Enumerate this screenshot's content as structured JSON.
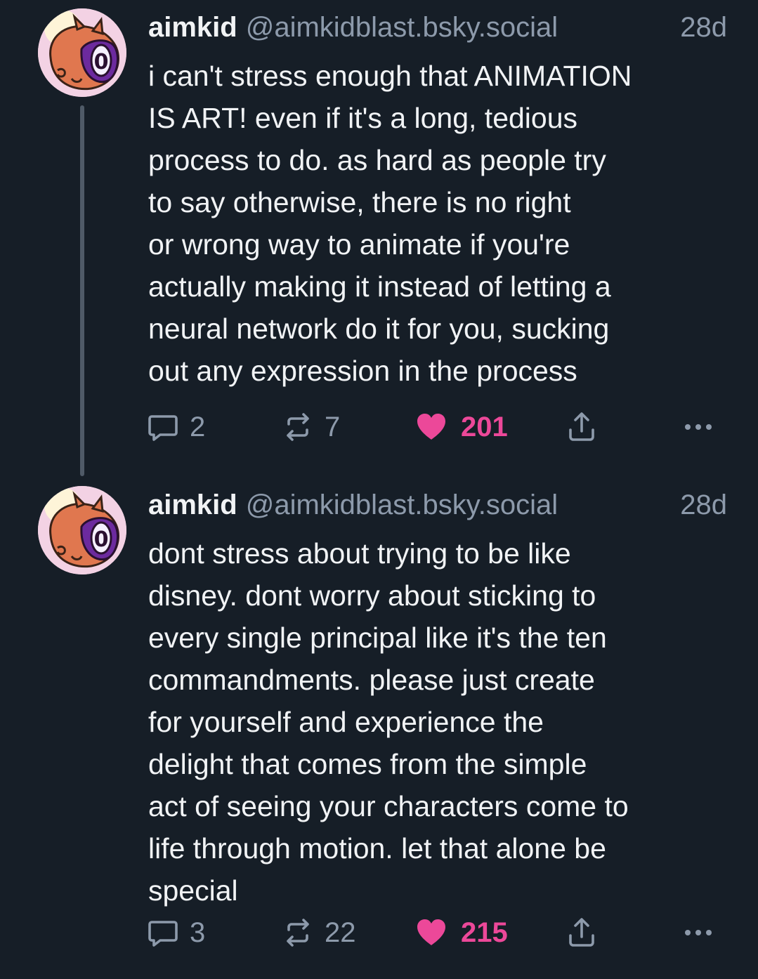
{
  "posts": [
    {
      "author": {
        "display_name": "aimkid",
        "handle": "@aimkidblast.bsky.social",
        "avatar_icon": "avatar-character-icon"
      },
      "time": "28d",
      "text": "i can't stress enough that ANIMATION\nIS ART! even if it's a long, tedious\nprocess to do. as hard as people try\nto say otherwise, there is no right\nor wrong way to animate if you're\nactually making it instead of letting a\nneural network do it for you, sucking\nout any expression in the process",
      "stats": {
        "replies": "2",
        "reposts": "7",
        "likes": "201"
      },
      "liked": true
    },
    {
      "author": {
        "display_name": "aimkid",
        "handle": "@aimkidblast.bsky.social",
        "avatar_icon": "avatar-character-icon"
      },
      "time": "28d",
      "text": "dont stress about trying to be like\ndisney. dont worry about sticking to\nevery single principal like it's the ten\ncommandments. please just create\nfor yourself and experience the\ndelight that comes from the simple\nact of seeing your characters come to\nlife through motion. let that alone be\nspecial",
      "stats": {
        "replies": "3",
        "reposts": "22",
        "likes": "215"
      },
      "liked": true
    }
  ],
  "theme": {
    "background": "#161e27",
    "text": "#f1f3f5",
    "muted": "#8d9aab",
    "like_color": "#ec4899",
    "thread_line": "#4f5a67"
  },
  "icons": {
    "reply": "reply-bubble-icon",
    "repost": "repost-arrows-icon",
    "like": "heart-icon",
    "share": "share-upload-icon",
    "more": "more-dots-icon"
  }
}
